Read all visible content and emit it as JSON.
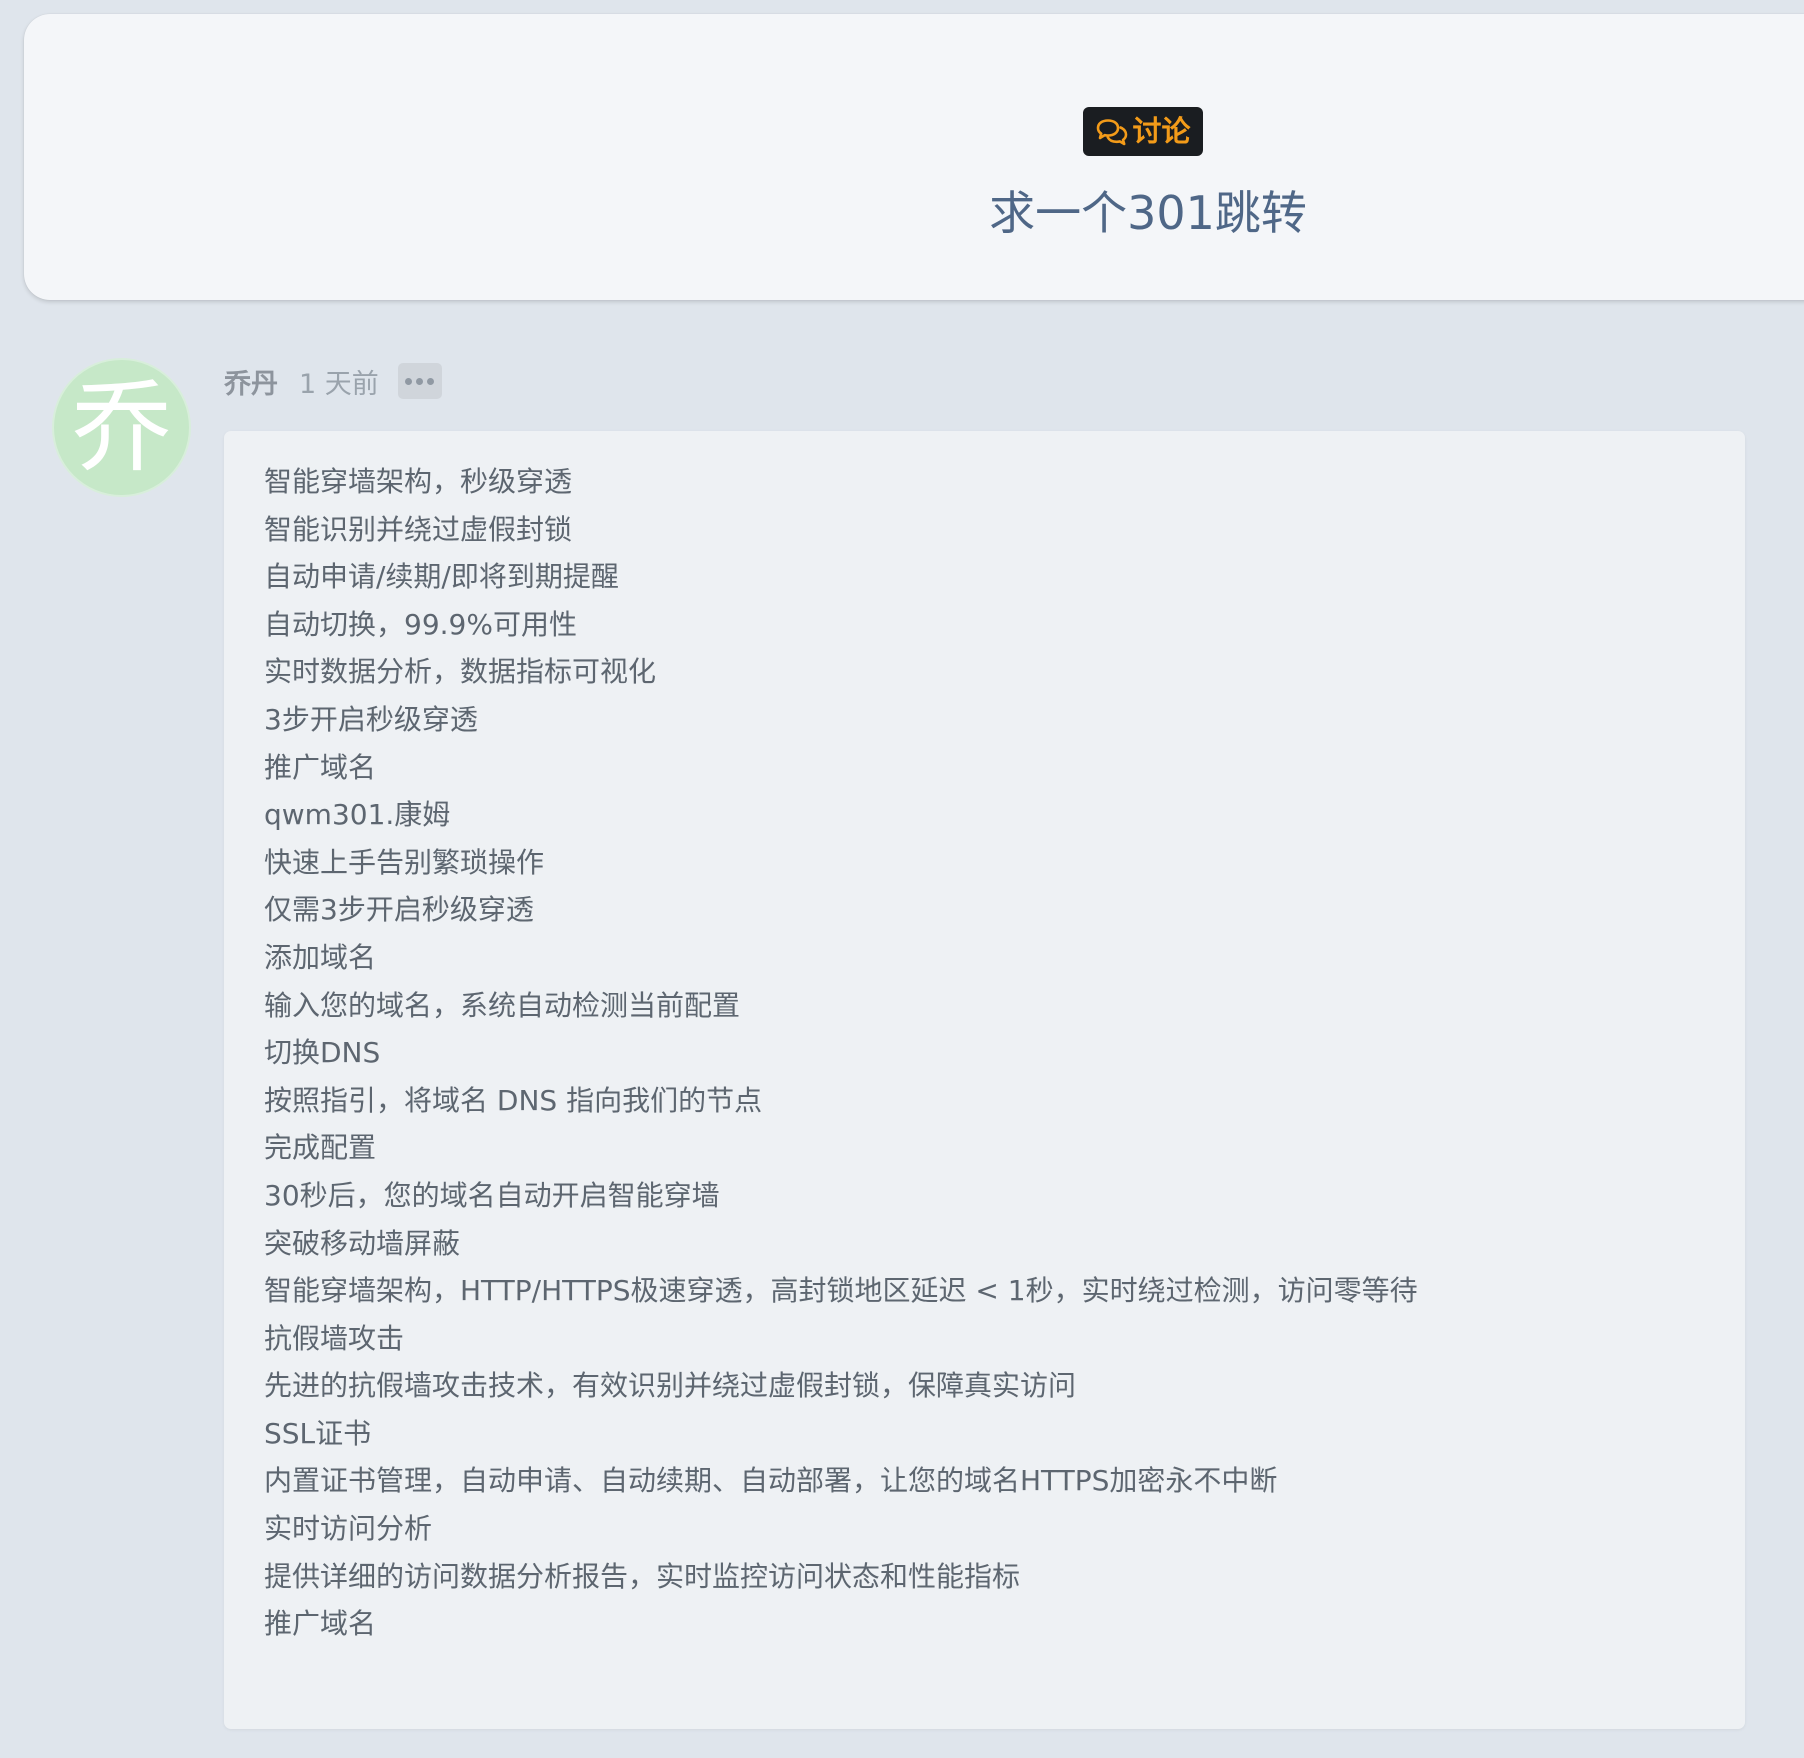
{
  "header": {
    "tag_label": "讨论",
    "tag_icon": "chat-bubbles-icon",
    "tag_color": "#f39b19",
    "title": "求一个301跳转"
  },
  "post": {
    "author": "乔丹",
    "avatar_text": "乔",
    "avatar_color": "#c6e8c8",
    "time": "1 天前",
    "more_icon": "ellipsis-icon",
    "lines": [
      "智能穿墙架构，秒级穿透",
      "智能识别并绕过虚假封锁",
      "自动申请/续期/即将到期提醒",
      "自动切换，99.9%可用性",
      "实时数据分析，数据指标可视化",
      "3步开启秒级穿透",
      "推广域名",
      "qwm301.康姆",
      "快速上手告别繁琐操作",
      "仅需3步开启秒级穿透",
      "添加域名",
      "输入您的域名，系统自动检测当前配置",
      "切换DNS",
      "按照指引，将域名 DNS 指向我们的节点",
      "完成配置",
      "30秒后，您的域名自动开启智能穿墙",
      "突破移动墙屏蔽",
      "智能穿墙架构，HTTP/HTTPS极速穿透，高封锁地区延迟 < 1秒，实时绕过检测，访问零等待",
      "抗假墙攻击",
      "先进的抗假墙攻击技术，有效识别并绕过虚假封锁，保障真实访问",
      "SSL证书",
      "内置证书管理，自动申请、自动续期、自动部署，让您的域名HTTPS加密永不中断",
      "实时访问分析",
      "提供详细的访问数据分析报告，实时监控访问状态和性能指标",
      "推广域名"
    ]
  }
}
